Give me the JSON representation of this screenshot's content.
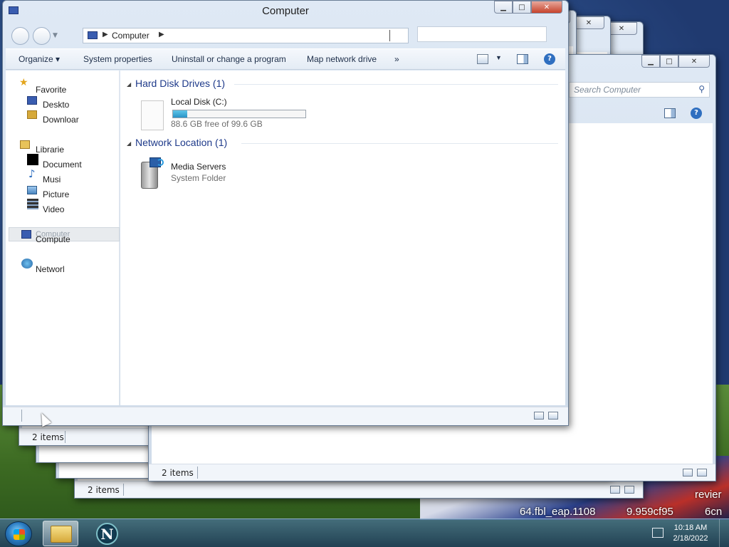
{
  "desktop": {
    "partial_texts": [
      "revier",
      "64.fbl_eap.1108",
      "9.959cf95",
      "6cn"
    ]
  },
  "main_window": {
    "title": "Computer",
    "address": {
      "crumb": "Computer"
    },
    "toolbar": {
      "organize": "Organize",
      "system_properties": "System properties",
      "uninstall": "Uninstall or change a program",
      "map_drive": "Map network drive",
      "more": "»"
    },
    "nav": {
      "favorites": "Favorite",
      "desktop": "Deskto",
      "downloads": "Downloar",
      "libraries": "Librarie",
      "documents": "Document",
      "music": "Musi",
      "pictures": "Picture",
      "videos": "Video",
      "computer_ghost": "Computer",
      "computer": "Compute",
      "network": "Networl"
    },
    "groups": [
      {
        "header": "Hard Disk Drives (1)",
        "item": {
          "name": "Local Disk (C:)",
          "detail": "88.6 GB free of 99.6 GB",
          "used_fraction": 0.11
        }
      },
      {
        "header": "Network Location (1)",
        "item": {
          "name": "Media Servers",
          "detail": "System Folder"
        }
      }
    ],
    "status_items": ""
  },
  "background_windows": {
    "search_placeholder": "Search Computer",
    "status_a": "2 items",
    "status_b": "2 items",
    "status_c": "2 items"
  },
  "taskbar": {
    "netscape_glyph": "N",
    "clock_time": "10:18 AM",
    "clock_date": "2/18/2022"
  },
  "colors": {
    "accent": "#1e3a8a",
    "usage_fill": "#2a93c7",
    "close_button": "#c7432c"
  }
}
